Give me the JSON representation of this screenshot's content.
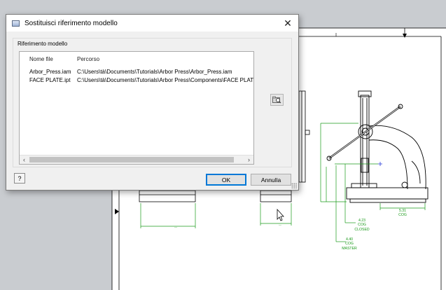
{
  "dialog": {
    "title": "Sostituisci riferimento modello",
    "group_label": "Riferimento modello",
    "columns": [
      "Nome file",
      "Percorso"
    ],
    "rows": [
      {
        "name": "Arbor_Press.iam",
        "path": "C:\\Users\\tà\\Documents\\Tutorials\\Arbor Press\\Arbor_Press.iam"
      },
      {
        "name": "FACE PLATE.ipt",
        "path": "C:\\Users\\tà\\Documents\\Tutorials\\Arbor Press\\Components\\FACE PLATE.ipt"
      }
    ],
    "ok_label": "OK",
    "cancel_label": "Annulla",
    "help_label": "?",
    "close_glyph": "✕"
  },
  "drawing": {
    "dims": {
      "cog_closed_value": "4.23",
      "cog_closed_l1": "COG",
      "cog_closed_l2": "CLOSED",
      "cog_master_value": "4.40",
      "cog_master_l1": "COG",
      "cog_master_l2": "MASTER",
      "right_value": "5.31",
      "right_label": "COG"
    },
    "line_color": "#000000",
    "dim_color": "#1a9a1a",
    "point_color": "#2a3cd8"
  },
  "icons": {
    "app": "window-icon",
    "browse": "folder-browse-icon",
    "close": "close-icon",
    "help": "help-icon",
    "cursor": "mouse-pointer-icon"
  }
}
